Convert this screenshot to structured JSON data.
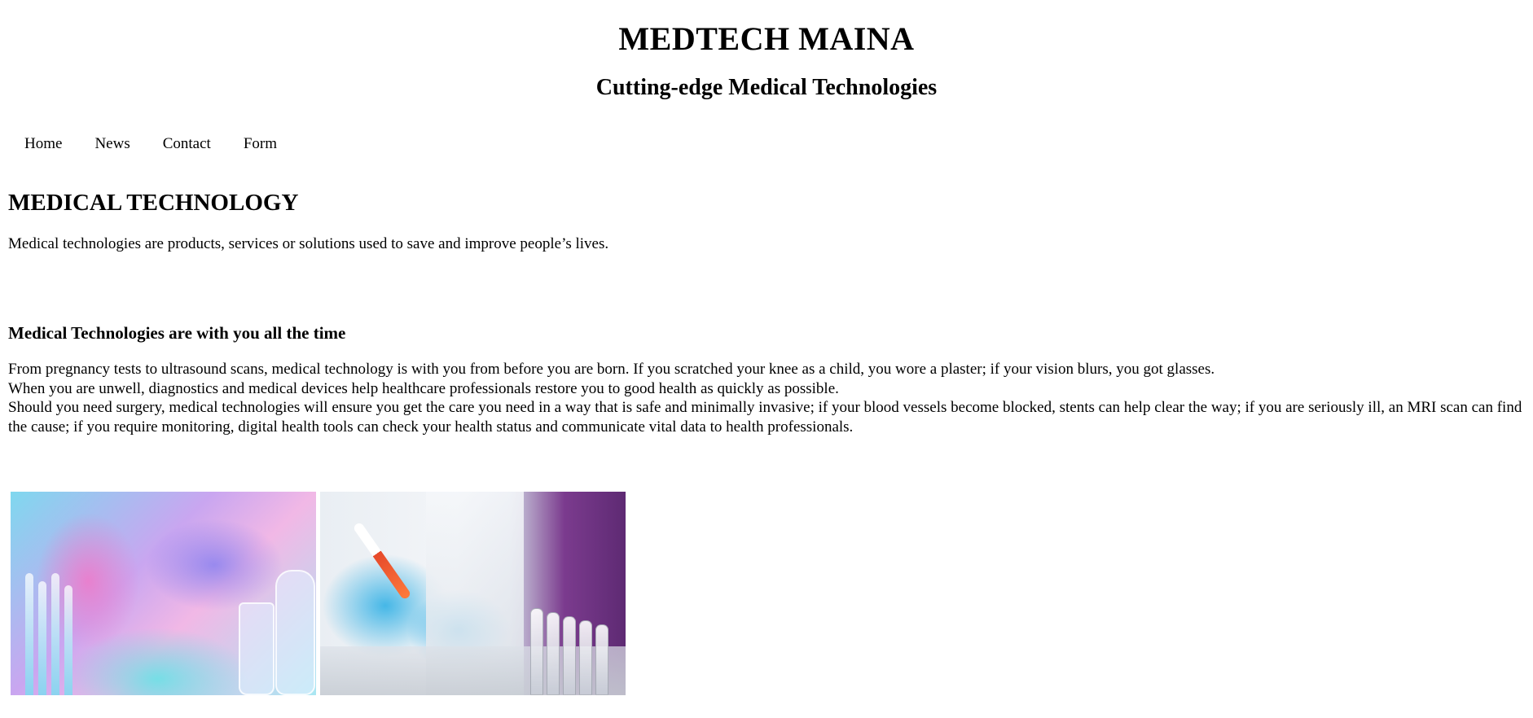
{
  "header": {
    "title": "MEDTECH MAINA",
    "subtitle": "Cutting-edge Medical Technologies"
  },
  "nav": {
    "items": [
      {
        "label": "Home"
      },
      {
        "label": "News"
      },
      {
        "label": "Contact"
      },
      {
        "label": "Form"
      }
    ]
  },
  "main": {
    "section_title": "MEDICAL TECHNOLOGY",
    "intro": "Medical technologies are products, services or solutions used to save and improve people’s lives.",
    "sub_heading": "Medical Technologies are with you all the time",
    "paragraph_lines": [
      "From pregnancy tests to ultrasound scans, medical technology is with you from before you are born. If you scratched your knee as a child, you wore a plaster; if your vision blurs, you got glasses.",
      "When you are unwell, diagnostics and medical devices help healthcare professionals restore you to good health as quickly as possible.",
      "Should you need surgery, medical technologies will ensure you get the care you need in a way that is safe and minimally invasive; if your blood vessels become blocked, stents can help clear the way; if you are seriously ill, an MRI scan can find the cause; if you require monitoring, digital health tools can check your health status and communicate vital data to health professionals."
    ]
  },
  "gallery": {
    "images": [
      {
        "subject": "lab-scientist-pipette-photo"
      },
      {
        "subject": "gloved-hands-dropper-photo"
      }
    ]
  }
}
